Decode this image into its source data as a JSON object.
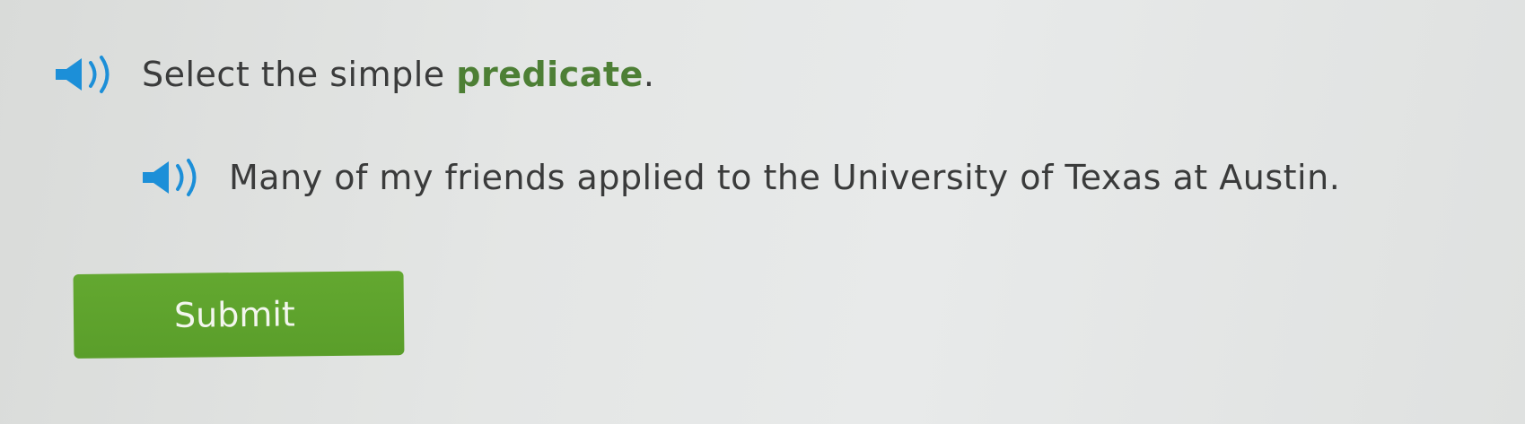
{
  "question": {
    "prompt_prefix": "Select the simple ",
    "prompt_keyword": "predicate",
    "prompt_suffix": ".",
    "sentence": "Many of my friends applied to the University of Texas at Austin."
  },
  "submit": {
    "label": "Submit"
  },
  "icons": {
    "audio": "speaker-icon"
  },
  "colors": {
    "audio_icon": "#1c8fd8",
    "keyword": "#4d7f35",
    "submit_bg": "#5fa42d",
    "text": "#3a3b3b"
  }
}
